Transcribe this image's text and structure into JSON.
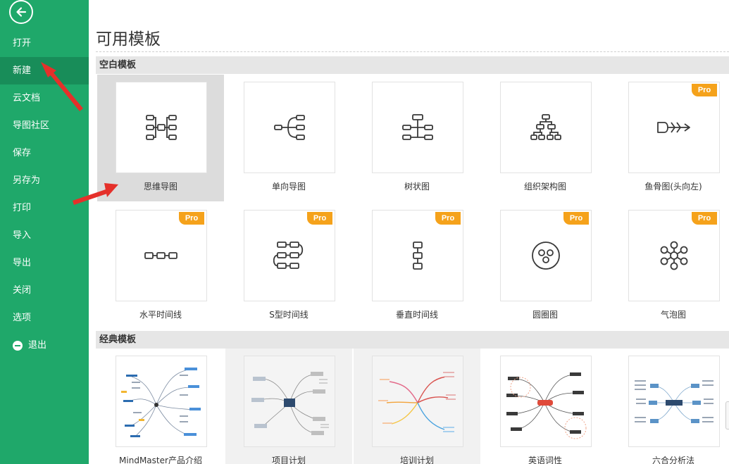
{
  "sidebar": {
    "items": [
      {
        "label": "打开"
      },
      {
        "label": "新建"
      },
      {
        "label": "云文档"
      },
      {
        "label": "导图社区"
      },
      {
        "label": "保存"
      },
      {
        "label": "另存为"
      },
      {
        "label": "打印"
      },
      {
        "label": "导入"
      },
      {
        "label": "导出"
      },
      {
        "label": "关闭"
      },
      {
        "label": "选项"
      },
      {
        "label": "退出"
      }
    ],
    "active_item": "新建"
  },
  "page_title": "可用模板",
  "sections": {
    "blank": {
      "title": "空白模板",
      "templates": [
        {
          "label": "思维导图",
          "pro": false,
          "icon": "mind-map-icon"
        },
        {
          "label": "单向导图",
          "pro": false,
          "icon": "one-way-map-icon"
        },
        {
          "label": "树状图",
          "pro": false,
          "icon": "tree-chart-icon"
        },
        {
          "label": "组织架构图",
          "pro": false,
          "icon": "org-chart-icon"
        },
        {
          "label": "鱼骨图(头向左)",
          "pro": true,
          "icon": "fishbone-icon"
        },
        {
          "label": "水平时间线",
          "pro": true,
          "icon": "horizontal-timeline-icon"
        },
        {
          "label": "S型时间线",
          "pro": true,
          "icon": "s-timeline-icon"
        },
        {
          "label": "垂直时间线",
          "pro": true,
          "icon": "vertical-timeline-icon"
        },
        {
          "label": "圆圈图",
          "pro": true,
          "icon": "circle-map-icon"
        },
        {
          "label": "气泡图",
          "pro": true,
          "icon": "bubble-map-icon"
        }
      ]
    },
    "classic": {
      "title": "经典模板",
      "templates": [
        {
          "label": "MindMaster产品介绍"
        },
        {
          "label": "项目计划"
        },
        {
          "label": "培训计划"
        },
        {
          "label": "英语词性"
        },
        {
          "label": "六合分析法"
        }
      ]
    }
  },
  "pro_badge": "Pro",
  "colors": {
    "sidebar_bg": "#1fa86a",
    "sidebar_active": "#188d59",
    "pro_badge": "#f5a21b",
    "annotation_arrow": "#e5302a"
  }
}
